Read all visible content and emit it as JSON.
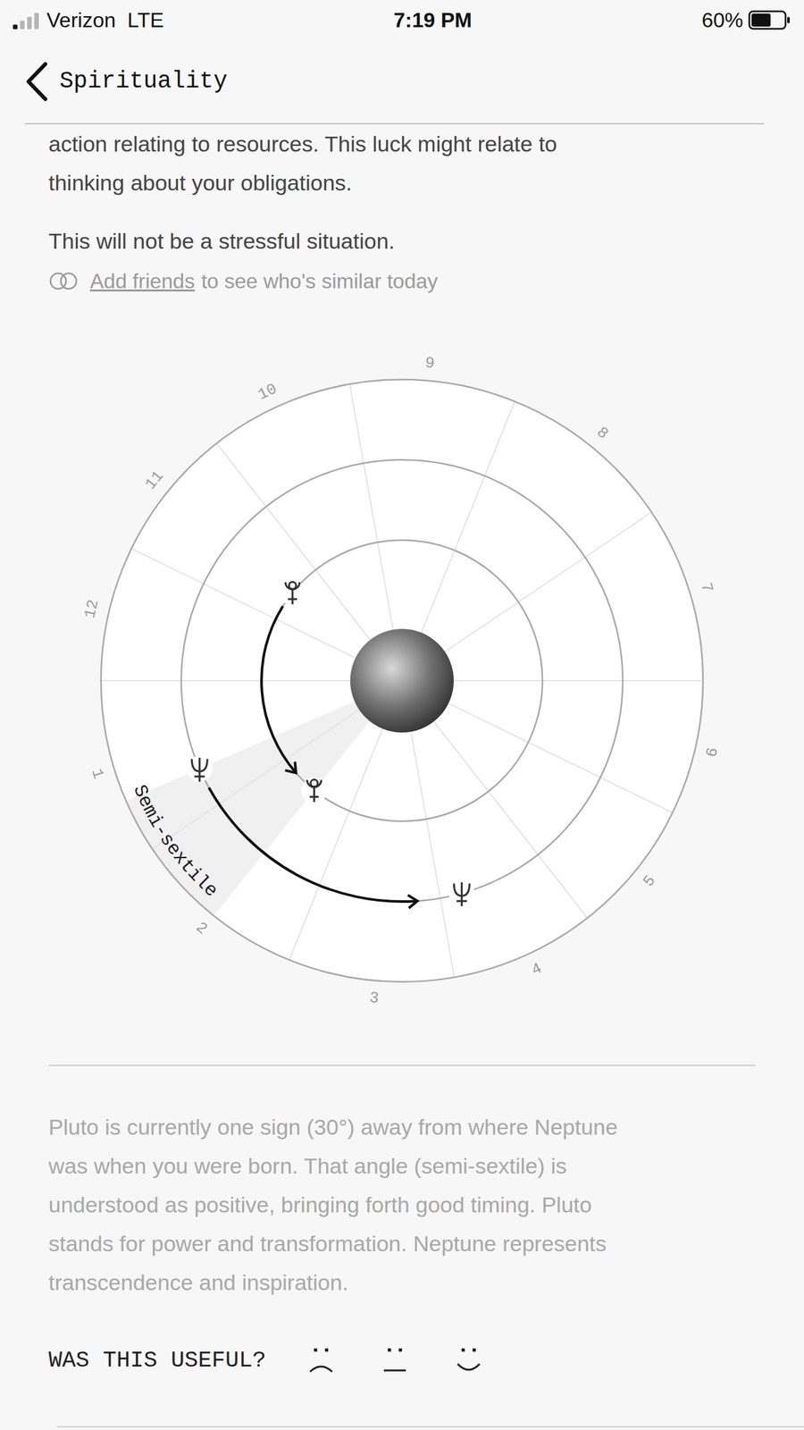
{
  "status_bar": {
    "carrier": "Verizon",
    "network": "LTE",
    "time": "7:19 PM",
    "signal": {
      "level": 0.25
    },
    "battery": {
      "text": "60%",
      "level": 0.6
    }
  },
  "nav": {
    "back_label": "Spirituality"
  },
  "reading": {
    "lines": [
      "action relating to resources. This luck might relate to",
      "thinking about your obligations."
    ],
    "stress": "This will not be a stressful situation."
  },
  "friends": {
    "link": "Add friends",
    "text": "to see who's similar today"
  },
  "chart": {
    "houses": [
      "1",
      "2",
      "3",
      "4",
      "5",
      "6",
      "7",
      "8",
      "9",
      "10",
      "11",
      "12"
    ],
    "aspect": "Semi-sextile"
  },
  "explanation": {
    "lines": [
      "Pluto is currently one sign (30°) away from where Neptune",
      "was when you were born. That angle (semi-sextile) is",
      "understood as positive, bringing forth good timing. Pluto",
      "stands for power and transformation. Neptune represents",
      "transcendence and inspiration."
    ]
  },
  "feedback": {
    "question": "WAS THIS USEFUL?"
  }
}
